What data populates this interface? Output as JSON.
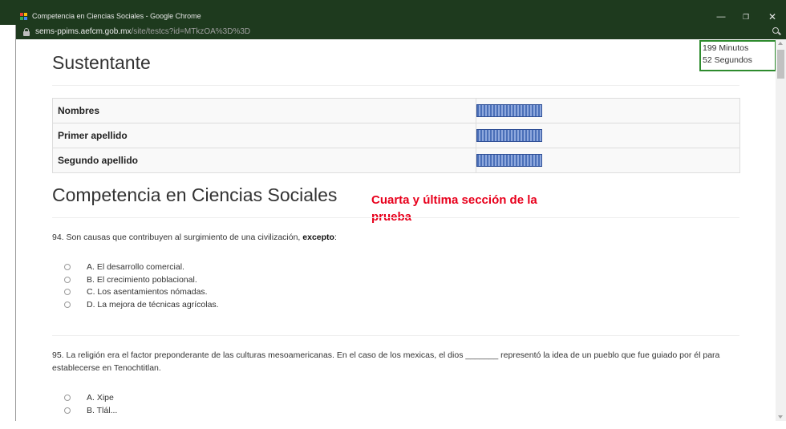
{
  "window": {
    "title": "Competencia en Ciencias Sociales - Google Chrome",
    "minimize_symbol": "—",
    "restore_symbol": "❐",
    "close_symbol": "✕"
  },
  "addressbar": {
    "url_host": "sems-ppims.aefcm.gob.mx",
    "url_path": "/site/testcs?id=MTkzOA%3D%3D"
  },
  "timer": {
    "minutes": "199 Minutos",
    "seconds": "52 Segundos"
  },
  "sustentante": {
    "heading": "Sustentante",
    "rows": [
      {
        "label": "Nombres"
      },
      {
        "label": "Primer apellido"
      },
      {
        "label": "Segundo apellido"
      }
    ]
  },
  "section": {
    "heading": "Competencia en Ciencias Sociales",
    "annotation": "Cuarta y última sección de la prueba"
  },
  "questions": [
    {
      "text_before": "94. Son causas que contribuyen al surgimiento de una civilización, ",
      "text_bold": "excepto",
      "text_after": ":",
      "options": [
        "A. El desarrollo comercial.",
        "B. El crecimiento poblacional.",
        "C. Los asentamientos nómadas.",
        "D. La mejora de técnicas agrícolas."
      ]
    },
    {
      "text": "95. La religión era el factor preponderante de las culturas mesoamericanas. En el caso de los mexicas, el dios _______ representó la idea de un pueblo que fue guiado por él para establecerse en Tenochtitlan.",
      "options": [
        "A. Xipe",
        "B. Tlál..."
      ]
    }
  ],
  "colors": {
    "titlebar_bg": "#1e3a1e",
    "annotation": "#e8001c",
    "timer_border": "#2e8b2e"
  }
}
